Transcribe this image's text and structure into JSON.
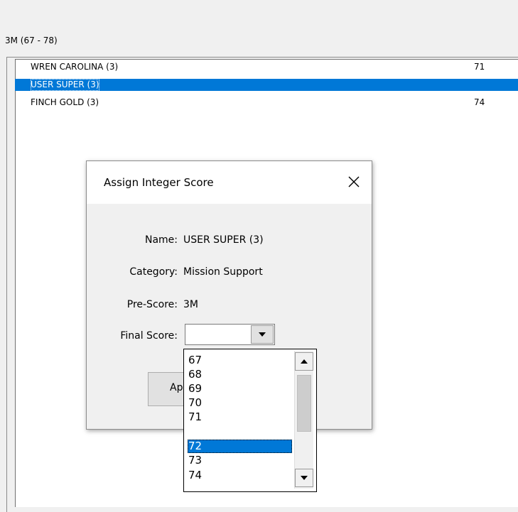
{
  "group": {
    "label": "3M (67 - 78)"
  },
  "list": {
    "rows": [
      {
        "name": "WREN CAROLINA  (3)",
        "score": "71",
        "selected": false
      },
      {
        "name": "USER SUPER (3)",
        "score": "",
        "selected": true
      },
      {
        "name": "FINCH GOLD (3)",
        "score": "74",
        "selected": false
      }
    ]
  },
  "dialog": {
    "title": "Assign Integer Score",
    "close_icon": "close-icon",
    "fields": {
      "name_label": "Name:",
      "name_value": "USER SUPER (3)",
      "category_label": "Category:",
      "category_value": "Mission Support",
      "prescore_label": "Pre-Score:",
      "prescore_value": "3M",
      "final_label": "Final Score:"
    },
    "final_score_value": "",
    "apply_label": "Ap"
  },
  "dropdown": {
    "options": [
      "67",
      "68",
      "69",
      "70",
      "71",
      "72",
      "73",
      "74"
    ],
    "selected": "72"
  },
  "colors": {
    "selection": "#0078d7",
    "window_bg": "#f0f0f0",
    "list_bg": "#ffffff"
  }
}
